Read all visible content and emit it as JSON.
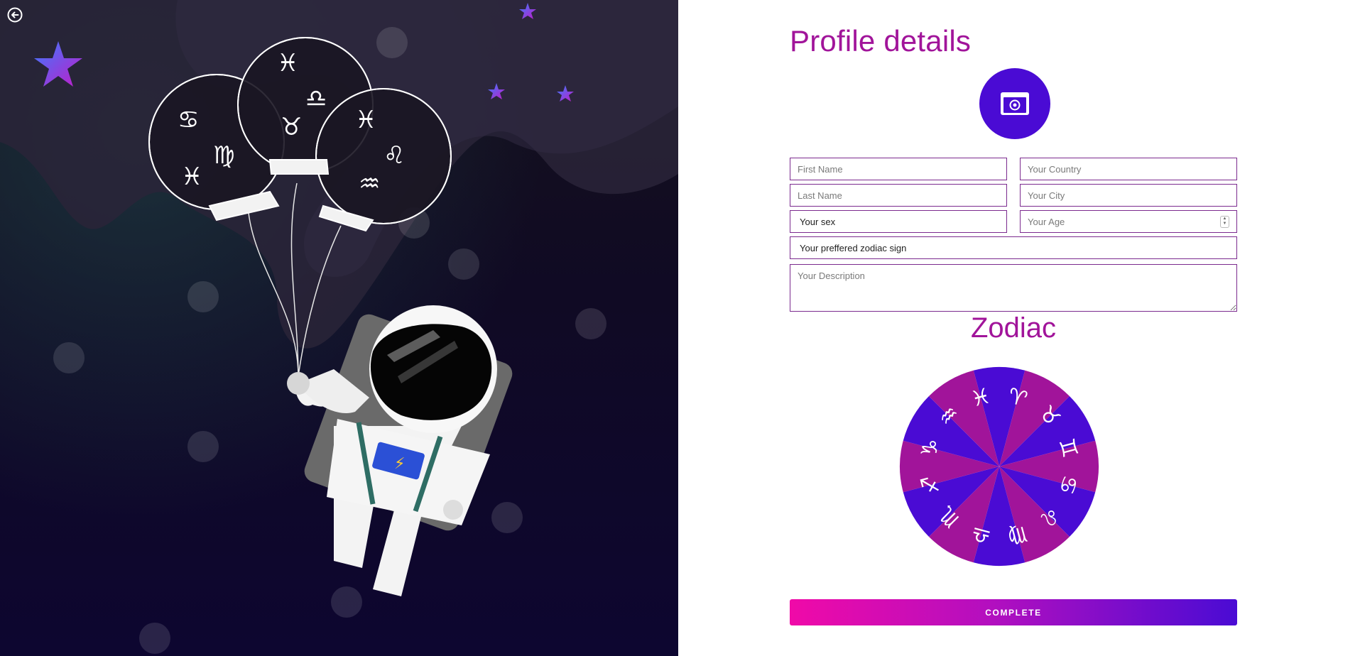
{
  "page": {
    "title": "Profile details",
    "zodiac_title": "Zodiac"
  },
  "icons": {
    "back": "back-arrow-circle-icon",
    "avatar": "camera-icon",
    "stars": "star-icon",
    "balloons": "zodiac-balloon-icon",
    "astronaut": "astronaut-illustration"
  },
  "form": {
    "first_name": {
      "placeholder": "First Name",
      "value": ""
    },
    "country": {
      "placeholder": "Your Country",
      "value": ""
    },
    "last_name": {
      "placeholder": "Last Name",
      "value": ""
    },
    "city": {
      "placeholder": "Your City",
      "value": ""
    },
    "sex": {
      "selected": "Your sex"
    },
    "age": {
      "placeholder": "Your Age",
      "value": ""
    },
    "zodiac_sign": {
      "selected": "Your preffered zodiac sign"
    },
    "description": {
      "placeholder": "Your Description",
      "value": ""
    }
  },
  "wheel": {
    "signs": [
      "♈",
      "♉",
      "♊",
      "♋",
      "♌",
      "♍",
      "♎",
      "♏",
      "♐",
      "♑",
      "♒",
      "♓"
    ],
    "colors": [
      "#4a0bd4",
      "#a1149a"
    ]
  },
  "actions": {
    "complete_label": "COMPLETE"
  },
  "colors": {
    "accent": "#a1149a",
    "primary": "#4a0bd4",
    "gradient_start": "#f00aa8",
    "gradient_end": "#4a0bd4",
    "field_border": "#7b2a8e",
    "background_dark": "#0d0630"
  }
}
